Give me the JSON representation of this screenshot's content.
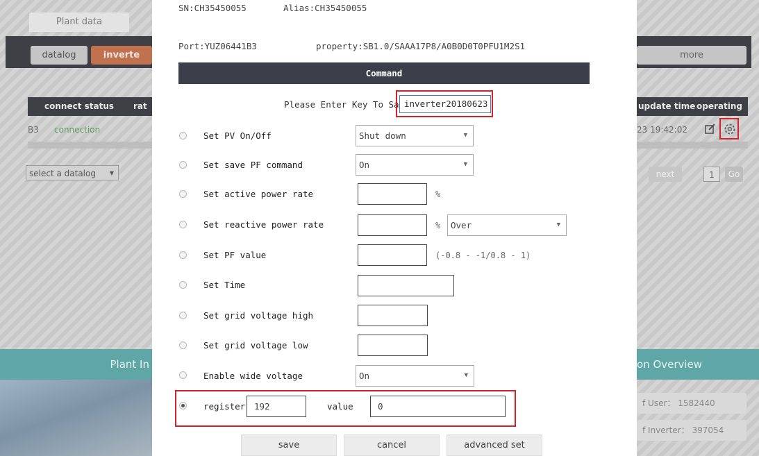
{
  "background": {
    "plant_data_tab": "Plant data",
    "datalog_tab": "datalog",
    "inverter_tab": "inverte",
    "more_tab": "more",
    "table_headers": {
      "connect_status": "connect status",
      "rate": "rat",
      "update_time": "update time",
      "operating": "operating"
    },
    "row": {
      "sn_fragment": "B3",
      "status": "connection",
      "time": "23 19:42:02"
    },
    "select_datalog": "select a datalog",
    "next_button": "next",
    "page_number": "1",
    "go_button": "Go",
    "plant_banner": "Plant In",
    "overview_banner": "on Overview",
    "user_stat": "f User： 1582440",
    "inverter_stat": "f Inverter： 397054"
  },
  "modal": {
    "sn_line_left": "SN:CH35450055",
    "sn_line_right": "Alias:CH35450055",
    "port": "Port:YUZ06441B3",
    "property": "property:SB1.0/SAAA17P8/A0B0D0T0PFU1M2S1",
    "command_title": "Command",
    "key_label": "Please Enter Key To Save",
    "key_value": "inverter20180623",
    "rows": [
      {
        "label": "Set PV On/Off",
        "select": "Shut down"
      },
      {
        "label": "Set save PF command",
        "select": "On"
      },
      {
        "label": "Set active power rate",
        "unit": "%"
      },
      {
        "label": "Set reactive power rate",
        "unit": "%",
        "select": "Over"
      },
      {
        "label": "Set PF value",
        "unit": "(-0.8 - -1/0.8 - 1)"
      },
      {
        "label": "Set Time"
      },
      {
        "label": "Set grid voltage high"
      },
      {
        "label": "Set grid voltage low"
      },
      {
        "label": "Enable wide voltage",
        "select": "On"
      }
    ],
    "register_label": "register",
    "register_value": "192",
    "value_label": "value",
    "value_value": "0",
    "buttons": {
      "save": "save",
      "cancel": "cancel",
      "advanced": "advanced set"
    }
  }
}
